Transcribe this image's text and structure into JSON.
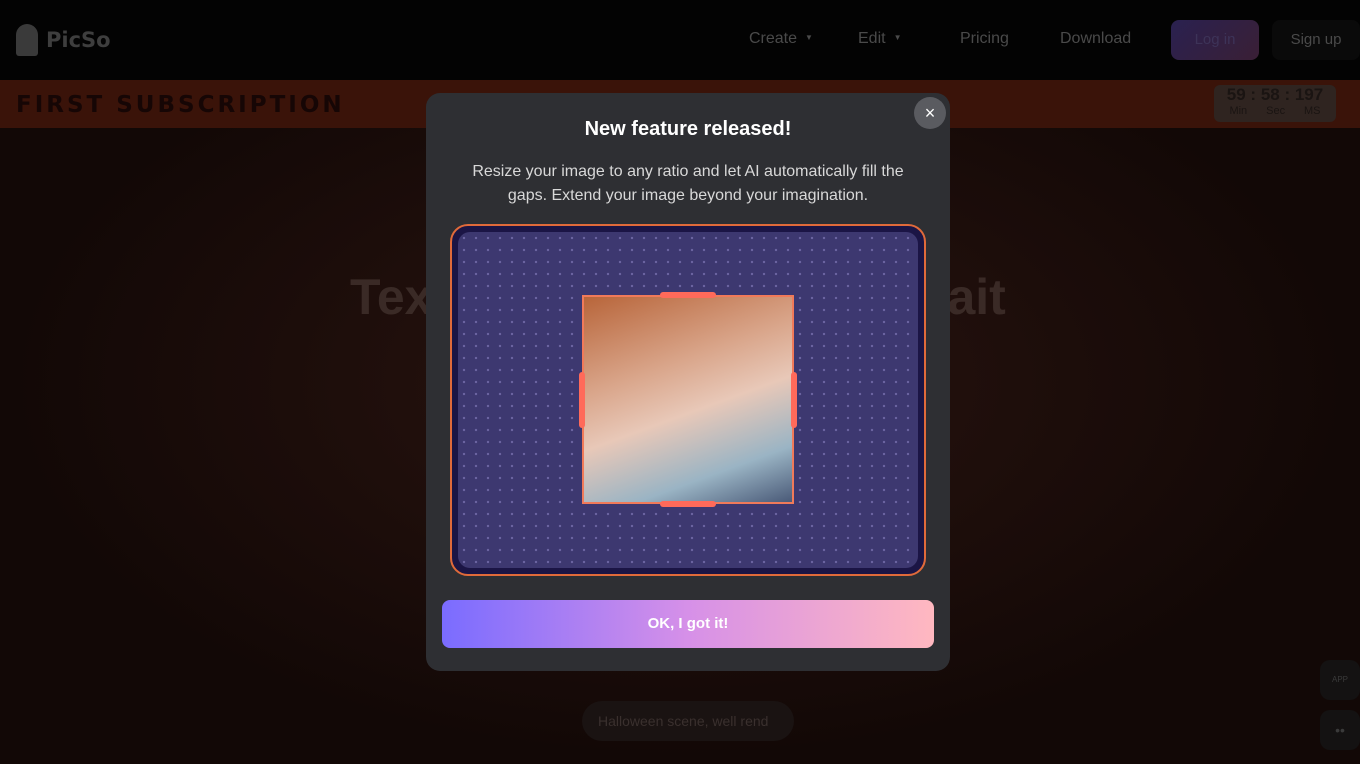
{
  "nav": {
    "brand": "PicSo",
    "items": [
      {
        "label": "Create",
        "has_dropdown": true
      },
      {
        "label": "Edit",
        "has_dropdown": true
      },
      {
        "label": "Pricing"
      },
      {
        "label": "Download"
      }
    ],
    "login": "Log in",
    "signup": "Sign up"
  },
  "banner": {
    "text": "FIRST SUBSCRIPTION",
    "timer": {
      "min": "59",
      "sec": "58",
      "ms": "197",
      "min_label": "Min",
      "sec_label": "Sec",
      "ms_label": "MS"
    }
  },
  "hero": {
    "title_left": "Tex",
    "title_right": "rait",
    "prompt": "Halloween scene, well rend"
  },
  "side": {
    "app": "APP"
  },
  "modal": {
    "title": "New feature released!",
    "description": "Resize your image to any ratio and let AI automatically fill the gaps. Extend your image beyond your imagination.",
    "ok": "OK, I got it!",
    "close": "×"
  },
  "colors": {
    "accent_start": "#7a6cff",
    "accent_end": "#ffb8c0",
    "banner": "#3a1309"
  }
}
